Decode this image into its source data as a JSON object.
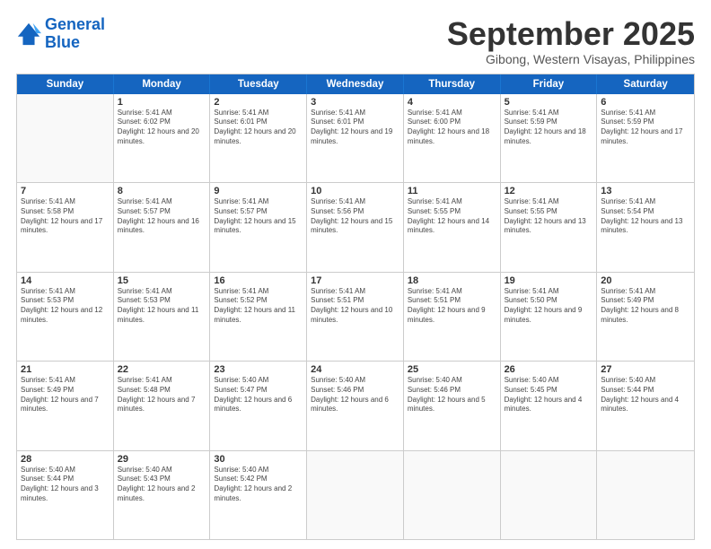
{
  "logo": {
    "line1": "General",
    "line2": "Blue"
  },
  "title": "September 2025",
  "subtitle": "Gibong, Western Visayas, Philippines",
  "header_days": [
    "Sunday",
    "Monday",
    "Tuesday",
    "Wednesday",
    "Thursday",
    "Friday",
    "Saturday"
  ],
  "weeks": [
    [
      {
        "day": "",
        "sunrise": "",
        "sunset": "",
        "daylight": ""
      },
      {
        "day": "1",
        "sunrise": "Sunrise: 5:41 AM",
        "sunset": "Sunset: 6:02 PM",
        "daylight": "Daylight: 12 hours and 20 minutes."
      },
      {
        "day": "2",
        "sunrise": "Sunrise: 5:41 AM",
        "sunset": "Sunset: 6:01 PM",
        "daylight": "Daylight: 12 hours and 20 minutes."
      },
      {
        "day": "3",
        "sunrise": "Sunrise: 5:41 AM",
        "sunset": "Sunset: 6:01 PM",
        "daylight": "Daylight: 12 hours and 19 minutes."
      },
      {
        "day": "4",
        "sunrise": "Sunrise: 5:41 AM",
        "sunset": "Sunset: 6:00 PM",
        "daylight": "Daylight: 12 hours and 18 minutes."
      },
      {
        "day": "5",
        "sunrise": "Sunrise: 5:41 AM",
        "sunset": "Sunset: 5:59 PM",
        "daylight": "Daylight: 12 hours and 18 minutes."
      },
      {
        "day": "6",
        "sunrise": "Sunrise: 5:41 AM",
        "sunset": "Sunset: 5:59 PM",
        "daylight": "Daylight: 12 hours and 17 minutes."
      }
    ],
    [
      {
        "day": "7",
        "sunrise": "Sunrise: 5:41 AM",
        "sunset": "Sunset: 5:58 PM",
        "daylight": "Daylight: 12 hours and 17 minutes."
      },
      {
        "day": "8",
        "sunrise": "Sunrise: 5:41 AM",
        "sunset": "Sunset: 5:57 PM",
        "daylight": "Daylight: 12 hours and 16 minutes."
      },
      {
        "day": "9",
        "sunrise": "Sunrise: 5:41 AM",
        "sunset": "Sunset: 5:57 PM",
        "daylight": "Daylight: 12 hours and 15 minutes."
      },
      {
        "day": "10",
        "sunrise": "Sunrise: 5:41 AM",
        "sunset": "Sunset: 5:56 PM",
        "daylight": "Daylight: 12 hours and 15 minutes."
      },
      {
        "day": "11",
        "sunrise": "Sunrise: 5:41 AM",
        "sunset": "Sunset: 5:55 PM",
        "daylight": "Daylight: 12 hours and 14 minutes."
      },
      {
        "day": "12",
        "sunrise": "Sunrise: 5:41 AM",
        "sunset": "Sunset: 5:55 PM",
        "daylight": "Daylight: 12 hours and 13 minutes."
      },
      {
        "day": "13",
        "sunrise": "Sunrise: 5:41 AM",
        "sunset": "Sunset: 5:54 PM",
        "daylight": "Daylight: 12 hours and 13 minutes."
      }
    ],
    [
      {
        "day": "14",
        "sunrise": "Sunrise: 5:41 AM",
        "sunset": "Sunset: 5:53 PM",
        "daylight": "Daylight: 12 hours and 12 minutes."
      },
      {
        "day": "15",
        "sunrise": "Sunrise: 5:41 AM",
        "sunset": "Sunset: 5:53 PM",
        "daylight": "Daylight: 12 hours and 11 minutes."
      },
      {
        "day": "16",
        "sunrise": "Sunrise: 5:41 AM",
        "sunset": "Sunset: 5:52 PM",
        "daylight": "Daylight: 12 hours and 11 minutes."
      },
      {
        "day": "17",
        "sunrise": "Sunrise: 5:41 AM",
        "sunset": "Sunset: 5:51 PM",
        "daylight": "Daylight: 12 hours and 10 minutes."
      },
      {
        "day": "18",
        "sunrise": "Sunrise: 5:41 AM",
        "sunset": "Sunset: 5:51 PM",
        "daylight": "Daylight: 12 hours and 9 minutes."
      },
      {
        "day": "19",
        "sunrise": "Sunrise: 5:41 AM",
        "sunset": "Sunset: 5:50 PM",
        "daylight": "Daylight: 12 hours and 9 minutes."
      },
      {
        "day": "20",
        "sunrise": "Sunrise: 5:41 AM",
        "sunset": "Sunset: 5:49 PM",
        "daylight": "Daylight: 12 hours and 8 minutes."
      }
    ],
    [
      {
        "day": "21",
        "sunrise": "Sunrise: 5:41 AM",
        "sunset": "Sunset: 5:49 PM",
        "daylight": "Daylight: 12 hours and 7 minutes."
      },
      {
        "day": "22",
        "sunrise": "Sunrise: 5:41 AM",
        "sunset": "Sunset: 5:48 PM",
        "daylight": "Daylight: 12 hours and 7 minutes."
      },
      {
        "day": "23",
        "sunrise": "Sunrise: 5:40 AM",
        "sunset": "Sunset: 5:47 PM",
        "daylight": "Daylight: 12 hours and 6 minutes."
      },
      {
        "day": "24",
        "sunrise": "Sunrise: 5:40 AM",
        "sunset": "Sunset: 5:46 PM",
        "daylight": "Daylight: 12 hours and 6 minutes."
      },
      {
        "day": "25",
        "sunrise": "Sunrise: 5:40 AM",
        "sunset": "Sunset: 5:46 PM",
        "daylight": "Daylight: 12 hours and 5 minutes."
      },
      {
        "day": "26",
        "sunrise": "Sunrise: 5:40 AM",
        "sunset": "Sunset: 5:45 PM",
        "daylight": "Daylight: 12 hours and 4 minutes."
      },
      {
        "day": "27",
        "sunrise": "Sunrise: 5:40 AM",
        "sunset": "Sunset: 5:44 PM",
        "daylight": "Daylight: 12 hours and 4 minutes."
      }
    ],
    [
      {
        "day": "28",
        "sunrise": "Sunrise: 5:40 AM",
        "sunset": "Sunset: 5:44 PM",
        "daylight": "Daylight: 12 hours and 3 minutes."
      },
      {
        "day": "29",
        "sunrise": "Sunrise: 5:40 AM",
        "sunset": "Sunset: 5:43 PM",
        "daylight": "Daylight: 12 hours and 2 minutes."
      },
      {
        "day": "30",
        "sunrise": "Sunrise: 5:40 AM",
        "sunset": "Sunset: 5:42 PM",
        "daylight": "Daylight: 12 hours and 2 minutes."
      },
      {
        "day": "",
        "sunrise": "",
        "sunset": "",
        "daylight": ""
      },
      {
        "day": "",
        "sunrise": "",
        "sunset": "",
        "daylight": ""
      },
      {
        "day": "",
        "sunrise": "",
        "sunset": "",
        "daylight": ""
      },
      {
        "day": "",
        "sunrise": "",
        "sunset": "",
        "daylight": ""
      }
    ]
  ]
}
